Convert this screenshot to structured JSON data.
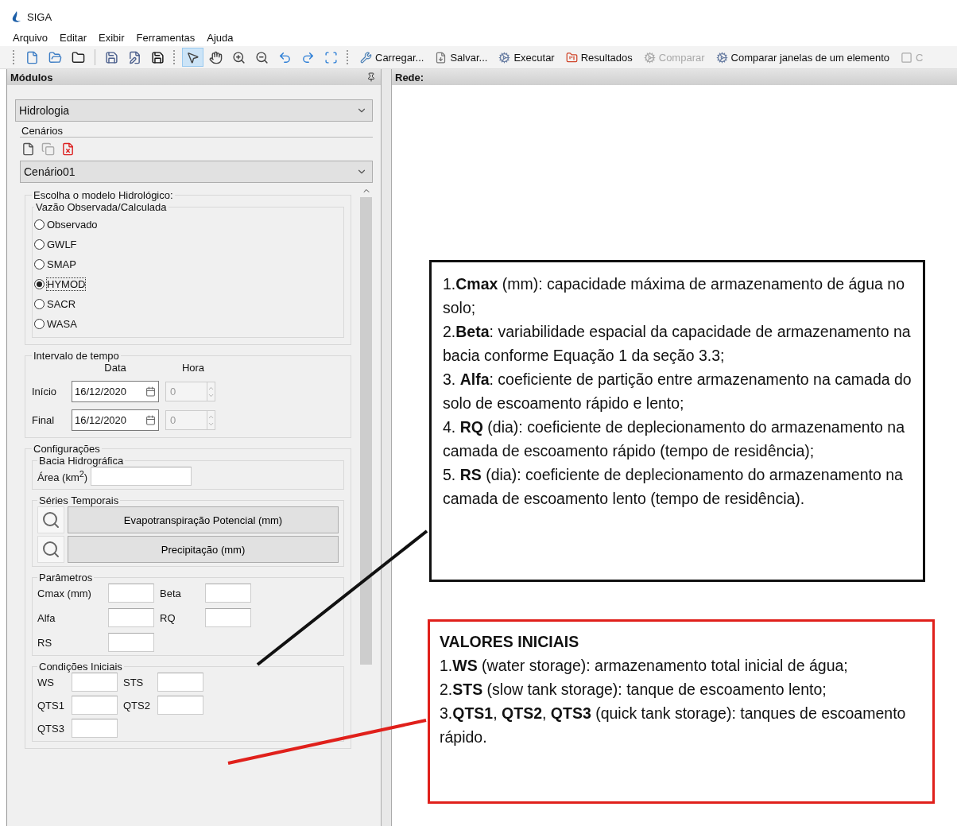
{
  "window": {
    "title": "SIGA"
  },
  "menu": [
    {
      "label": "Arquivo"
    },
    {
      "label": "Editar"
    },
    {
      "label": "Exibir"
    },
    {
      "label": "Ferramentas"
    },
    {
      "label": "Ajuda"
    }
  ],
  "toolbar": {
    "tools": [
      {
        "selected": true
      },
      {
        "selected": false
      },
      {
        "selected": false
      },
      {
        "selected": false
      },
      {
        "selected": false
      },
      {
        "selected": false
      },
      {
        "selected": false
      }
    ],
    "actions": [
      {
        "label": "Carregar...",
        "disabled": false
      },
      {
        "label": "Salvar...",
        "disabled": false
      },
      {
        "label": "Executar",
        "disabled": false
      },
      {
        "label": "Resultados",
        "disabled": false
      },
      {
        "label": "Comparar",
        "disabled": true
      },
      {
        "label": "Comparar janelas de um elemento",
        "disabled": false
      },
      {
        "label": "C",
        "disabled": true
      }
    ]
  },
  "modules_panel": {
    "title": "Módulos",
    "module": "Hidrologia",
    "scenarios": {
      "title": "Cenários",
      "value": "Cenário01"
    },
    "model_group": {
      "title": "Escolha o modelo Hidrológico:",
      "subtitle": "Vazão Observada/Calculada",
      "options": [
        {
          "label": "Observado",
          "selected": false
        },
        {
          "label": "GWLF",
          "selected": false
        },
        {
          "label": "SMAP",
          "selected": false
        },
        {
          "label": "HYMOD",
          "selected": true
        },
        {
          "label": "SACR",
          "selected": false
        },
        {
          "label": "WASA",
          "selected": false
        }
      ]
    },
    "interval": {
      "title": "Intervalo de tempo",
      "date_header": "Data",
      "hour_header": "Hora",
      "rows": [
        {
          "label": "Início",
          "date": "16/12/2020",
          "hour": "0",
          "hour_disabled": true
        },
        {
          "label": "Final",
          "date": "16/12/2020",
          "hour": "0",
          "hour_disabled": true
        }
      ]
    },
    "config": {
      "title": "Configurações",
      "basin": {
        "title": "Bacia Hidrográfica",
        "label": "Área (km$^{2}$)"
      },
      "series": {
        "title": "Séries Temporais",
        "buttons": [
          "Evapotranspiração Potencial (mm)",
          "Precipitação (mm)"
        ]
      },
      "parameters": {
        "title": "Parâmetros",
        "fields": [
          "Cmax (mm)",
          "Beta",
          "Alfa",
          "RQ",
          "RS"
        ]
      },
      "initial": {
        "title": "Condições Iniciais",
        "fields": [
          "WS",
          "STS",
          "QTS1",
          "QTS2",
          "QTS3"
        ]
      }
    }
  },
  "network_panel": {
    "title": "Rede:"
  },
  "callouts": [
    {
      "kind": "parameters",
      "items": [
        "1.**Cmax** (mm): capacidade máxima de armazenamento de água no solo;",
        "2.**Beta**: variabilidade espacial da capacidade de armazenamento na bacia conforme Equação 1 da seção 3.3;",
        "3. **Alfa**: coeficiente de partição entre armazenamento na camada do solo de escoamento rápido e lento;",
        "4. **RQ** (dia): coeficiente de deplecionamento do armazenamento na camada de escoamento rápido (tempo de residência);",
        "5. **RS** (dia): coeficiente de deplecionamento do armazenamento na camada de escoamento lento (tempo de residência)."
      ]
    },
    {
      "kind": "initial",
      "title": "VALORES INICIAIS",
      "items": [
        "1.**WS** (water storage): armazenamento total inicial de água;",
        "2.**STS** (slow tank storage): tanque de escoamento lento;",
        "3.**QTS1**, **QTS2**, **QTS3** (quick tank storage): tanques de escoamento rápido."
      ]
    }
  ]
}
